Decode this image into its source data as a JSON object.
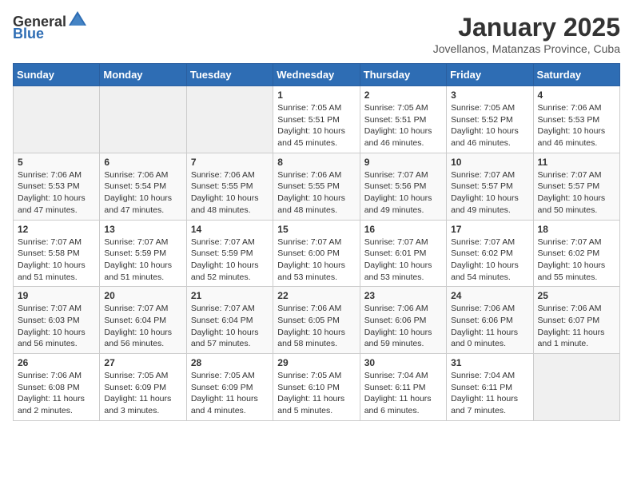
{
  "header": {
    "logo_general": "General",
    "logo_blue": "Blue",
    "month": "January 2025",
    "location": "Jovellanos, Matanzas Province, Cuba"
  },
  "weekdays": [
    "Sunday",
    "Monday",
    "Tuesday",
    "Wednesday",
    "Thursday",
    "Friday",
    "Saturday"
  ],
  "weeks": [
    [
      {
        "day": "",
        "info": ""
      },
      {
        "day": "",
        "info": ""
      },
      {
        "day": "",
        "info": ""
      },
      {
        "day": "1",
        "info": "Sunrise: 7:05 AM\nSunset: 5:51 PM\nDaylight: 10 hours\nand 45 minutes."
      },
      {
        "day": "2",
        "info": "Sunrise: 7:05 AM\nSunset: 5:51 PM\nDaylight: 10 hours\nand 46 minutes."
      },
      {
        "day": "3",
        "info": "Sunrise: 7:05 AM\nSunset: 5:52 PM\nDaylight: 10 hours\nand 46 minutes."
      },
      {
        "day": "4",
        "info": "Sunrise: 7:06 AM\nSunset: 5:53 PM\nDaylight: 10 hours\nand 46 minutes."
      }
    ],
    [
      {
        "day": "5",
        "info": "Sunrise: 7:06 AM\nSunset: 5:53 PM\nDaylight: 10 hours\nand 47 minutes."
      },
      {
        "day": "6",
        "info": "Sunrise: 7:06 AM\nSunset: 5:54 PM\nDaylight: 10 hours\nand 47 minutes."
      },
      {
        "day": "7",
        "info": "Sunrise: 7:06 AM\nSunset: 5:55 PM\nDaylight: 10 hours\nand 48 minutes."
      },
      {
        "day": "8",
        "info": "Sunrise: 7:06 AM\nSunset: 5:55 PM\nDaylight: 10 hours\nand 48 minutes."
      },
      {
        "day": "9",
        "info": "Sunrise: 7:07 AM\nSunset: 5:56 PM\nDaylight: 10 hours\nand 49 minutes."
      },
      {
        "day": "10",
        "info": "Sunrise: 7:07 AM\nSunset: 5:57 PM\nDaylight: 10 hours\nand 49 minutes."
      },
      {
        "day": "11",
        "info": "Sunrise: 7:07 AM\nSunset: 5:57 PM\nDaylight: 10 hours\nand 50 minutes."
      }
    ],
    [
      {
        "day": "12",
        "info": "Sunrise: 7:07 AM\nSunset: 5:58 PM\nDaylight: 10 hours\nand 51 minutes."
      },
      {
        "day": "13",
        "info": "Sunrise: 7:07 AM\nSunset: 5:59 PM\nDaylight: 10 hours\nand 51 minutes."
      },
      {
        "day": "14",
        "info": "Sunrise: 7:07 AM\nSunset: 5:59 PM\nDaylight: 10 hours\nand 52 minutes."
      },
      {
        "day": "15",
        "info": "Sunrise: 7:07 AM\nSunset: 6:00 PM\nDaylight: 10 hours\nand 53 minutes."
      },
      {
        "day": "16",
        "info": "Sunrise: 7:07 AM\nSunset: 6:01 PM\nDaylight: 10 hours\nand 53 minutes."
      },
      {
        "day": "17",
        "info": "Sunrise: 7:07 AM\nSunset: 6:02 PM\nDaylight: 10 hours\nand 54 minutes."
      },
      {
        "day": "18",
        "info": "Sunrise: 7:07 AM\nSunset: 6:02 PM\nDaylight: 10 hours\nand 55 minutes."
      }
    ],
    [
      {
        "day": "19",
        "info": "Sunrise: 7:07 AM\nSunset: 6:03 PM\nDaylight: 10 hours\nand 56 minutes."
      },
      {
        "day": "20",
        "info": "Sunrise: 7:07 AM\nSunset: 6:04 PM\nDaylight: 10 hours\nand 56 minutes."
      },
      {
        "day": "21",
        "info": "Sunrise: 7:07 AM\nSunset: 6:04 PM\nDaylight: 10 hours\nand 57 minutes."
      },
      {
        "day": "22",
        "info": "Sunrise: 7:06 AM\nSunset: 6:05 PM\nDaylight: 10 hours\nand 58 minutes."
      },
      {
        "day": "23",
        "info": "Sunrise: 7:06 AM\nSunset: 6:06 PM\nDaylight: 10 hours\nand 59 minutes."
      },
      {
        "day": "24",
        "info": "Sunrise: 7:06 AM\nSunset: 6:06 PM\nDaylight: 11 hours\nand 0 minutes."
      },
      {
        "day": "25",
        "info": "Sunrise: 7:06 AM\nSunset: 6:07 PM\nDaylight: 11 hours\nand 1 minute."
      }
    ],
    [
      {
        "day": "26",
        "info": "Sunrise: 7:06 AM\nSunset: 6:08 PM\nDaylight: 11 hours\nand 2 minutes."
      },
      {
        "day": "27",
        "info": "Sunrise: 7:05 AM\nSunset: 6:09 PM\nDaylight: 11 hours\nand 3 minutes."
      },
      {
        "day": "28",
        "info": "Sunrise: 7:05 AM\nSunset: 6:09 PM\nDaylight: 11 hours\nand 4 minutes."
      },
      {
        "day": "29",
        "info": "Sunrise: 7:05 AM\nSunset: 6:10 PM\nDaylight: 11 hours\nand 5 minutes."
      },
      {
        "day": "30",
        "info": "Sunrise: 7:04 AM\nSunset: 6:11 PM\nDaylight: 11 hours\nand 6 minutes."
      },
      {
        "day": "31",
        "info": "Sunrise: 7:04 AM\nSunset: 6:11 PM\nDaylight: 11 hours\nand 7 minutes."
      },
      {
        "day": "",
        "info": ""
      }
    ]
  ]
}
